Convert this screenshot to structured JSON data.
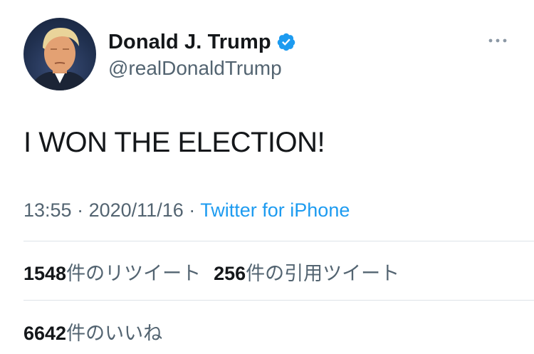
{
  "author": {
    "display_name": "Donald J. Trump",
    "handle": "@realDonaldTrump",
    "verified": true
  },
  "tweet": {
    "text": "I WON THE ELECTION!",
    "time": "13:55",
    "date": "2020/11/16",
    "separator": "·",
    "source": "Twitter for iPhone"
  },
  "stats": {
    "retweets_count": "1548",
    "retweets_label": "件のリツイート",
    "quotes_count": "256",
    "quotes_label": "件の引用ツイート",
    "likes_count": "6642",
    "likes_label": "件のいいね"
  },
  "icons": {
    "verified": "verified-badge-icon",
    "more": "more-options-icon"
  },
  "colors": {
    "accent": "#1d9bf0",
    "secondary_text": "#536471",
    "primary_text": "#14171a",
    "divider": "#dde3e8"
  }
}
